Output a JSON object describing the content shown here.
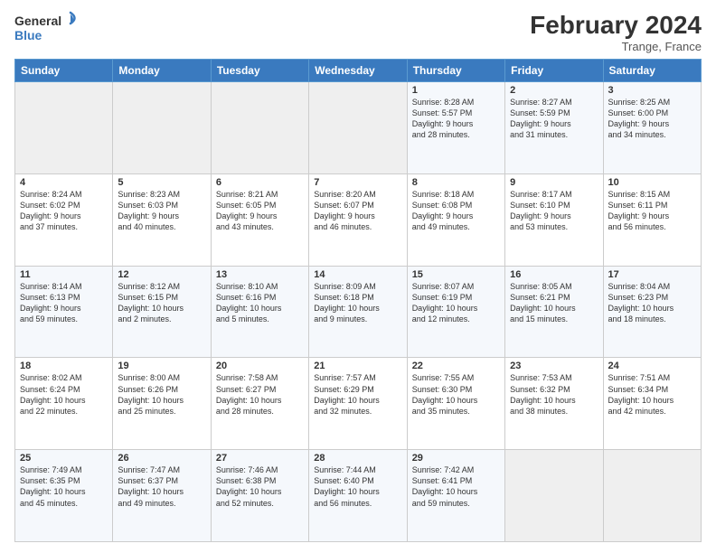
{
  "header": {
    "logo_line1": "General",
    "logo_line2": "Blue",
    "month_title": "February 2024",
    "location": "Trange, France"
  },
  "weekdays": [
    "Sunday",
    "Monday",
    "Tuesday",
    "Wednesday",
    "Thursday",
    "Friday",
    "Saturday"
  ],
  "weeks": [
    [
      {
        "num": "",
        "info": ""
      },
      {
        "num": "",
        "info": ""
      },
      {
        "num": "",
        "info": ""
      },
      {
        "num": "",
        "info": ""
      },
      {
        "num": "1",
        "info": "Sunrise: 8:28 AM\nSunset: 5:57 PM\nDaylight: 9 hours\nand 28 minutes."
      },
      {
        "num": "2",
        "info": "Sunrise: 8:27 AM\nSunset: 5:59 PM\nDaylight: 9 hours\nand 31 minutes."
      },
      {
        "num": "3",
        "info": "Sunrise: 8:25 AM\nSunset: 6:00 PM\nDaylight: 9 hours\nand 34 minutes."
      }
    ],
    [
      {
        "num": "4",
        "info": "Sunrise: 8:24 AM\nSunset: 6:02 PM\nDaylight: 9 hours\nand 37 minutes."
      },
      {
        "num": "5",
        "info": "Sunrise: 8:23 AM\nSunset: 6:03 PM\nDaylight: 9 hours\nand 40 minutes."
      },
      {
        "num": "6",
        "info": "Sunrise: 8:21 AM\nSunset: 6:05 PM\nDaylight: 9 hours\nand 43 minutes."
      },
      {
        "num": "7",
        "info": "Sunrise: 8:20 AM\nSunset: 6:07 PM\nDaylight: 9 hours\nand 46 minutes."
      },
      {
        "num": "8",
        "info": "Sunrise: 8:18 AM\nSunset: 6:08 PM\nDaylight: 9 hours\nand 49 minutes."
      },
      {
        "num": "9",
        "info": "Sunrise: 8:17 AM\nSunset: 6:10 PM\nDaylight: 9 hours\nand 53 minutes."
      },
      {
        "num": "10",
        "info": "Sunrise: 8:15 AM\nSunset: 6:11 PM\nDaylight: 9 hours\nand 56 minutes."
      }
    ],
    [
      {
        "num": "11",
        "info": "Sunrise: 8:14 AM\nSunset: 6:13 PM\nDaylight: 9 hours\nand 59 minutes."
      },
      {
        "num": "12",
        "info": "Sunrise: 8:12 AM\nSunset: 6:15 PM\nDaylight: 10 hours\nand 2 minutes."
      },
      {
        "num": "13",
        "info": "Sunrise: 8:10 AM\nSunset: 6:16 PM\nDaylight: 10 hours\nand 5 minutes."
      },
      {
        "num": "14",
        "info": "Sunrise: 8:09 AM\nSunset: 6:18 PM\nDaylight: 10 hours\nand 9 minutes."
      },
      {
        "num": "15",
        "info": "Sunrise: 8:07 AM\nSunset: 6:19 PM\nDaylight: 10 hours\nand 12 minutes."
      },
      {
        "num": "16",
        "info": "Sunrise: 8:05 AM\nSunset: 6:21 PM\nDaylight: 10 hours\nand 15 minutes."
      },
      {
        "num": "17",
        "info": "Sunrise: 8:04 AM\nSunset: 6:23 PM\nDaylight: 10 hours\nand 18 minutes."
      }
    ],
    [
      {
        "num": "18",
        "info": "Sunrise: 8:02 AM\nSunset: 6:24 PM\nDaylight: 10 hours\nand 22 minutes."
      },
      {
        "num": "19",
        "info": "Sunrise: 8:00 AM\nSunset: 6:26 PM\nDaylight: 10 hours\nand 25 minutes."
      },
      {
        "num": "20",
        "info": "Sunrise: 7:58 AM\nSunset: 6:27 PM\nDaylight: 10 hours\nand 28 minutes."
      },
      {
        "num": "21",
        "info": "Sunrise: 7:57 AM\nSunset: 6:29 PM\nDaylight: 10 hours\nand 32 minutes."
      },
      {
        "num": "22",
        "info": "Sunrise: 7:55 AM\nSunset: 6:30 PM\nDaylight: 10 hours\nand 35 minutes."
      },
      {
        "num": "23",
        "info": "Sunrise: 7:53 AM\nSunset: 6:32 PM\nDaylight: 10 hours\nand 38 minutes."
      },
      {
        "num": "24",
        "info": "Sunrise: 7:51 AM\nSunset: 6:34 PM\nDaylight: 10 hours\nand 42 minutes."
      }
    ],
    [
      {
        "num": "25",
        "info": "Sunrise: 7:49 AM\nSunset: 6:35 PM\nDaylight: 10 hours\nand 45 minutes."
      },
      {
        "num": "26",
        "info": "Sunrise: 7:47 AM\nSunset: 6:37 PM\nDaylight: 10 hours\nand 49 minutes."
      },
      {
        "num": "27",
        "info": "Sunrise: 7:46 AM\nSunset: 6:38 PM\nDaylight: 10 hours\nand 52 minutes."
      },
      {
        "num": "28",
        "info": "Sunrise: 7:44 AM\nSunset: 6:40 PM\nDaylight: 10 hours\nand 56 minutes."
      },
      {
        "num": "29",
        "info": "Sunrise: 7:42 AM\nSunset: 6:41 PM\nDaylight: 10 hours\nand 59 minutes."
      },
      {
        "num": "",
        "info": ""
      },
      {
        "num": "",
        "info": ""
      }
    ]
  ]
}
